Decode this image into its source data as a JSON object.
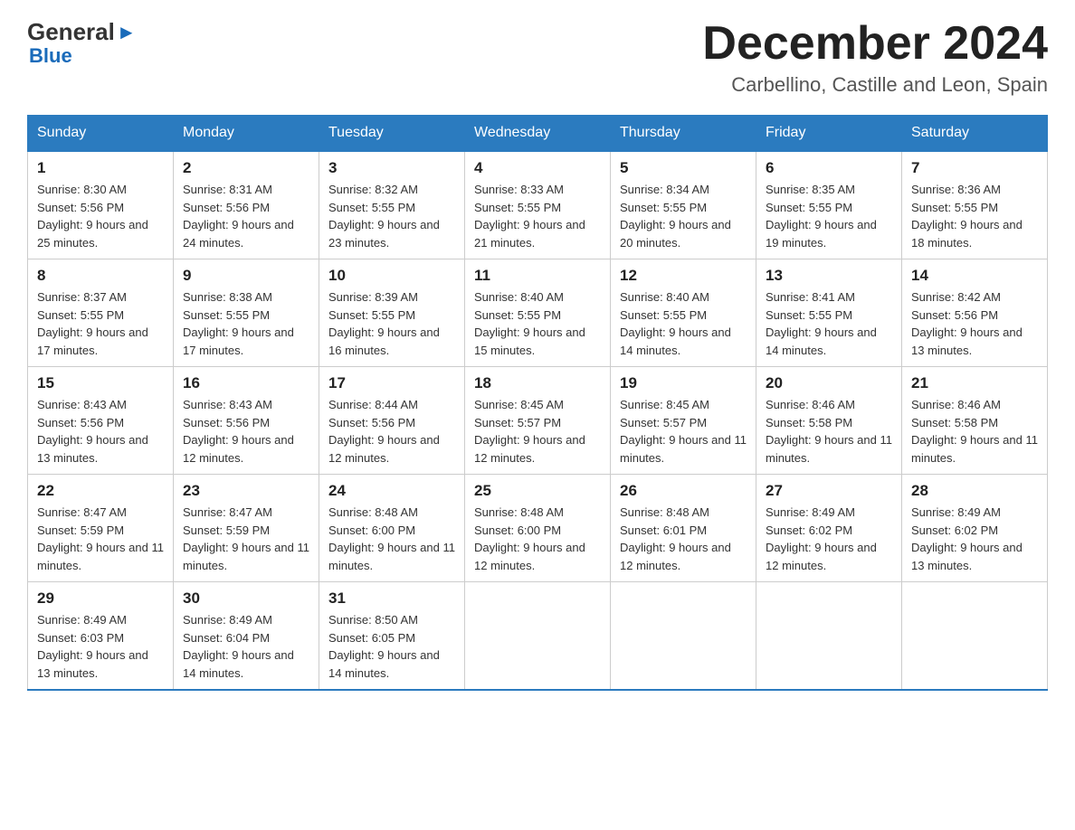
{
  "header": {
    "logo_line1": "General",
    "logo_arrow": "▶",
    "logo_line2": "Blue",
    "month_title": "December 2024",
    "location": "Carbellino, Castille and Leon, Spain"
  },
  "days_of_week": [
    "Sunday",
    "Monday",
    "Tuesday",
    "Wednesday",
    "Thursday",
    "Friday",
    "Saturday"
  ],
  "weeks": [
    [
      {
        "day": "1",
        "sunrise": "8:30 AM",
        "sunset": "5:56 PM",
        "daylight": "9 hours and 25 minutes."
      },
      {
        "day": "2",
        "sunrise": "8:31 AM",
        "sunset": "5:56 PM",
        "daylight": "9 hours and 24 minutes."
      },
      {
        "day": "3",
        "sunrise": "8:32 AM",
        "sunset": "5:55 PM",
        "daylight": "9 hours and 23 minutes."
      },
      {
        "day": "4",
        "sunrise": "8:33 AM",
        "sunset": "5:55 PM",
        "daylight": "9 hours and 21 minutes."
      },
      {
        "day": "5",
        "sunrise": "8:34 AM",
        "sunset": "5:55 PM",
        "daylight": "9 hours and 20 minutes."
      },
      {
        "day": "6",
        "sunrise": "8:35 AM",
        "sunset": "5:55 PM",
        "daylight": "9 hours and 19 minutes."
      },
      {
        "day": "7",
        "sunrise": "8:36 AM",
        "sunset": "5:55 PM",
        "daylight": "9 hours and 18 minutes."
      }
    ],
    [
      {
        "day": "8",
        "sunrise": "8:37 AM",
        "sunset": "5:55 PM",
        "daylight": "9 hours and 17 minutes."
      },
      {
        "day": "9",
        "sunrise": "8:38 AM",
        "sunset": "5:55 PM",
        "daylight": "9 hours and 17 minutes."
      },
      {
        "day": "10",
        "sunrise": "8:39 AM",
        "sunset": "5:55 PM",
        "daylight": "9 hours and 16 minutes."
      },
      {
        "day": "11",
        "sunrise": "8:40 AM",
        "sunset": "5:55 PM",
        "daylight": "9 hours and 15 minutes."
      },
      {
        "day": "12",
        "sunrise": "8:40 AM",
        "sunset": "5:55 PM",
        "daylight": "9 hours and 14 minutes."
      },
      {
        "day": "13",
        "sunrise": "8:41 AM",
        "sunset": "5:55 PM",
        "daylight": "9 hours and 14 minutes."
      },
      {
        "day": "14",
        "sunrise": "8:42 AM",
        "sunset": "5:56 PM",
        "daylight": "9 hours and 13 minutes."
      }
    ],
    [
      {
        "day": "15",
        "sunrise": "8:43 AM",
        "sunset": "5:56 PM",
        "daylight": "9 hours and 13 minutes."
      },
      {
        "day": "16",
        "sunrise": "8:43 AM",
        "sunset": "5:56 PM",
        "daylight": "9 hours and 12 minutes."
      },
      {
        "day": "17",
        "sunrise": "8:44 AM",
        "sunset": "5:56 PM",
        "daylight": "9 hours and 12 minutes."
      },
      {
        "day": "18",
        "sunrise": "8:45 AM",
        "sunset": "5:57 PM",
        "daylight": "9 hours and 12 minutes."
      },
      {
        "day": "19",
        "sunrise": "8:45 AM",
        "sunset": "5:57 PM",
        "daylight": "9 hours and 11 minutes."
      },
      {
        "day": "20",
        "sunrise": "8:46 AM",
        "sunset": "5:58 PM",
        "daylight": "9 hours and 11 minutes."
      },
      {
        "day": "21",
        "sunrise": "8:46 AM",
        "sunset": "5:58 PM",
        "daylight": "9 hours and 11 minutes."
      }
    ],
    [
      {
        "day": "22",
        "sunrise": "8:47 AM",
        "sunset": "5:59 PM",
        "daylight": "9 hours and 11 minutes."
      },
      {
        "day": "23",
        "sunrise": "8:47 AM",
        "sunset": "5:59 PM",
        "daylight": "9 hours and 11 minutes."
      },
      {
        "day": "24",
        "sunrise": "8:48 AM",
        "sunset": "6:00 PM",
        "daylight": "9 hours and 11 minutes."
      },
      {
        "day": "25",
        "sunrise": "8:48 AM",
        "sunset": "6:00 PM",
        "daylight": "9 hours and 12 minutes."
      },
      {
        "day": "26",
        "sunrise": "8:48 AM",
        "sunset": "6:01 PM",
        "daylight": "9 hours and 12 minutes."
      },
      {
        "day": "27",
        "sunrise": "8:49 AM",
        "sunset": "6:02 PM",
        "daylight": "9 hours and 12 minutes."
      },
      {
        "day": "28",
        "sunrise": "8:49 AM",
        "sunset": "6:02 PM",
        "daylight": "9 hours and 13 minutes."
      }
    ],
    [
      {
        "day": "29",
        "sunrise": "8:49 AM",
        "sunset": "6:03 PM",
        "daylight": "9 hours and 13 minutes."
      },
      {
        "day": "30",
        "sunrise": "8:49 AM",
        "sunset": "6:04 PM",
        "daylight": "9 hours and 14 minutes."
      },
      {
        "day": "31",
        "sunrise": "8:50 AM",
        "sunset": "6:05 PM",
        "daylight": "9 hours and 14 minutes."
      },
      null,
      null,
      null,
      null
    ]
  ]
}
